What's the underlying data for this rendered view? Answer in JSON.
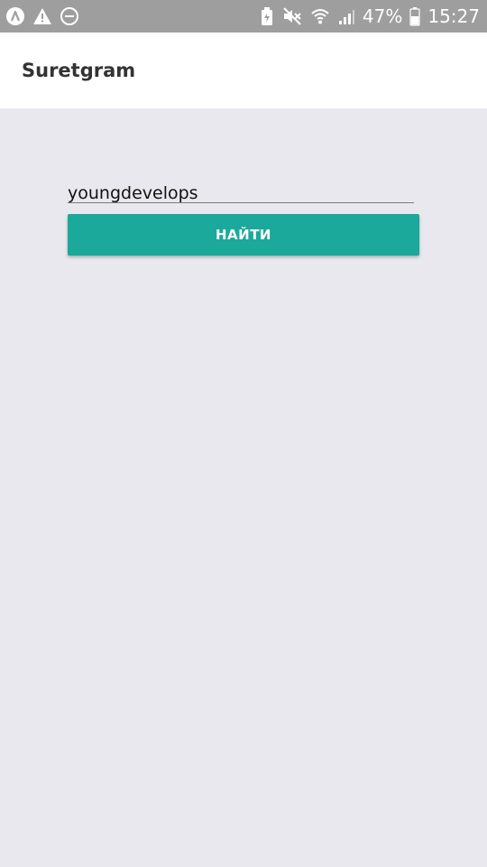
{
  "status_bar": {
    "left_icons": [
      "app-notification-icon",
      "warning-icon",
      "do-not-disturb-icon"
    ],
    "right_icons": [
      "battery-saver-icon",
      "mute-icon",
      "wifi-icon",
      "signal-icon",
      "battery-icon"
    ],
    "battery_percent": "47%",
    "time": "15:27"
  },
  "app_bar": {
    "title": "Suretgram"
  },
  "search": {
    "value": "youngdevelops",
    "button_label": "НАЙТИ"
  },
  "colors": {
    "status_bar_bg": "#9e9e9e",
    "app_bar_bg": "#ffffff",
    "content_bg": "#e9e8ee",
    "accent": "#1aa99a"
  }
}
